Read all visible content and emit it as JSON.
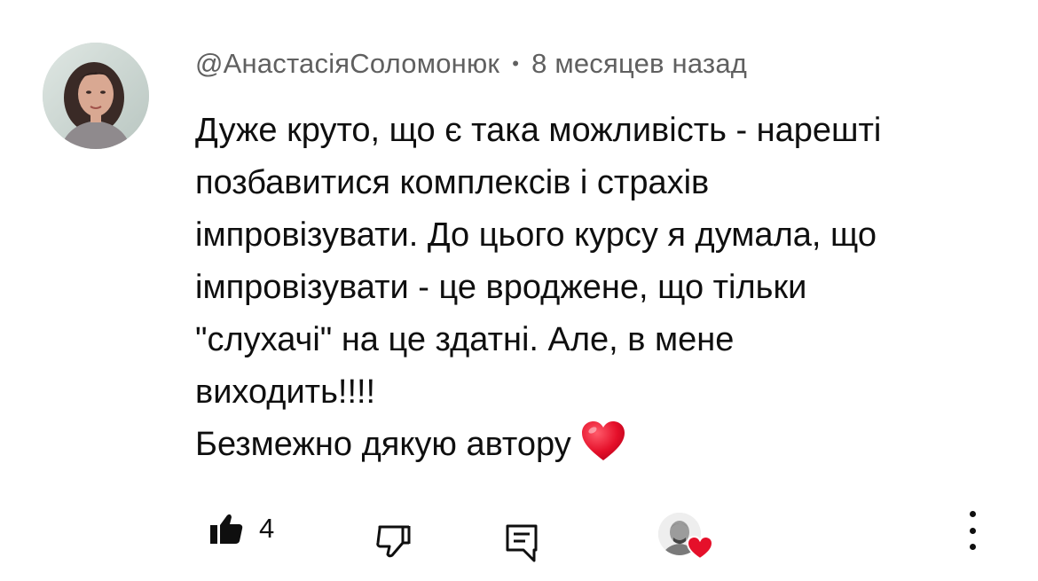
{
  "comment": {
    "author": "@АнастасіяСоломонюк",
    "separator": "•",
    "time": "8 месяцев назад",
    "lines": [
      "Дуже круто, що є така можливість - нарешті",
      "позбавитися комплексів і страхів",
      "імпровізувати. До цього курсу я думала, що",
      "імпровізувати - це вроджене, що тільки",
      "\"слухачі\" на це здатні. Але, в мене",
      "виходить!!!!",
      "Безмежно дякую автору"
    ],
    "emoji": "red-heart"
  },
  "actions": {
    "like_count": "4",
    "icons": {
      "like": "thumbs-up-filled-icon",
      "dislike": "thumbs-down-icon",
      "reply": "reply-comment-icon",
      "creator_heart": "creator-heart-badge",
      "more": "more-vertical-icon"
    }
  },
  "colors": {
    "text": "#0f0f0f",
    "meta": "#606060",
    "heart": "#e5102a",
    "background": "#ffffff"
  }
}
